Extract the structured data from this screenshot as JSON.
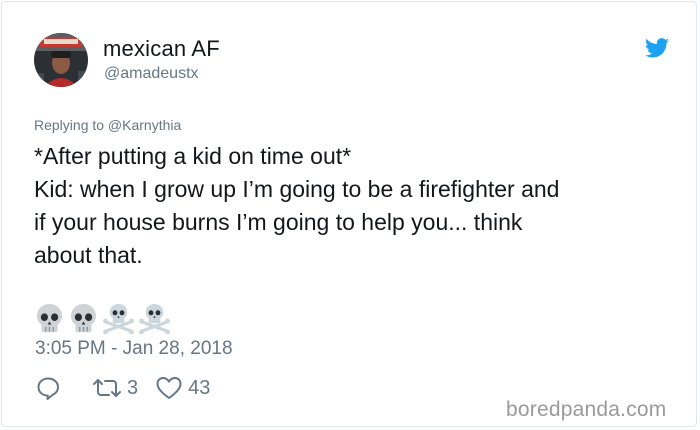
{
  "user": {
    "display_name": "mexican AF",
    "handle": "@amadeustx"
  },
  "reply": {
    "text": "Replying to @Karnythia"
  },
  "tweet": {
    "lines": [
      "*After putting a kid on time out*",
      "Kid: when I grow up I’m going to be a firefighter and",
      "if your house burns I’m going to help you... think",
      "about that."
    ],
    "emojis": [
      "skull-emoji",
      "skull-emoji",
      "skull-and-crossbones-emoji",
      "skull-and-crossbones-emoji"
    ],
    "timestamp": "3:05 PM - Jan 28, 2018"
  },
  "actions": {
    "reply_icon": "reply-icon",
    "retweet_icon": "retweet-icon",
    "retweet_count": "3",
    "like_icon": "heart-icon",
    "like_count": "43"
  },
  "watermark": "boredpanda.com",
  "colors": {
    "text_primary": "#14171a",
    "text_secondary": "#657786",
    "twitter_blue": "#1da1f2",
    "border": "#e1e8ed",
    "watermark": "#9a9a9a"
  }
}
